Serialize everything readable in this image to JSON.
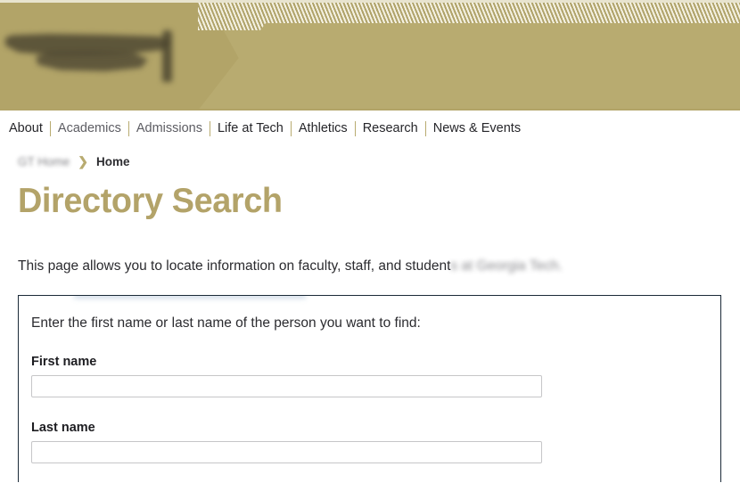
{
  "header": {
    "logo_alt": "Georgia Tech",
    "brand_gold": "#b8ab70",
    "stripe_light": "#f4f1e2",
    "stripe_dark": "#b0a36a"
  },
  "nav": {
    "items": [
      {
        "label": "About",
        "dim": false
      },
      {
        "label": "Academics",
        "dim": true
      },
      {
        "label": "Admissions",
        "dim": true
      },
      {
        "label": "Life at Tech",
        "dim": false
      },
      {
        "label": "Athletics",
        "dim": false
      },
      {
        "label": "Research",
        "dim": false
      },
      {
        "label": "News & Events",
        "dim": false
      }
    ]
  },
  "breadcrumb": {
    "parent": "GT Home",
    "separator": "❯",
    "current": "Home"
  },
  "page": {
    "title": "Directory Search",
    "title_color": "#b3a369",
    "intro_visible": "This page allows you to locate information on faculty, staff, and student",
    "intro_blurred": "s at Georgia Tech."
  },
  "search_form": {
    "prompt": "Enter the first name or last name of the person you want to find:",
    "fields": [
      {
        "label": "First name",
        "value": "",
        "placeholder": ""
      },
      {
        "label": "Last name",
        "value": "",
        "placeholder": ""
      }
    ]
  }
}
